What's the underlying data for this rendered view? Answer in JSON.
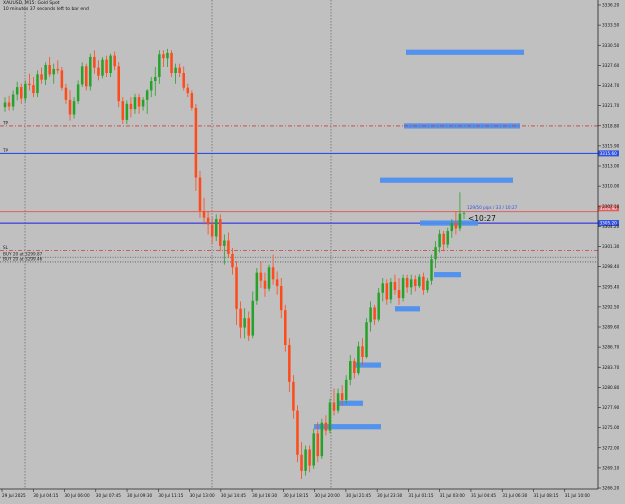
{
  "window": {
    "symbol_line": "XAUUSD, M15:  Gold Spot",
    "timer_line": "10 minutes 37 seconds left to bar end"
  },
  "colors": {
    "background": "#c0c0c0",
    "bull": "#26a22a",
    "bear": "#ff4a1a",
    "zone": "#4d8fef",
    "level_blue": "#1f3ff0",
    "level_red": "#d23b3b",
    "ask_line": "#e06060",
    "bid_line": "#1a1ae6",
    "grid": "#555555",
    "price_tag": "#3050e0"
  },
  "chart_data": {
    "type": "candlestick",
    "symbol": "XAUUSD",
    "timeframe": "M15",
    "ylim": [
      3265.5,
      3338.5
    ],
    "y_ticks": [
      "3336.20",
      "3333.50",
      "3330.50",
      "3327.60",
      "3324.70",
      "3321.70",
      "3318.80",
      "3315.90",
      "3313.00",
      "3310.00",
      "3307.10",
      "3304.20",
      "3301.30",
      "3298.40",
      "3295.40",
      "3292.50",
      "3289.60",
      "3286.70",
      "3283.70",
      "3280.80",
      "3277.90",
      "3275.00",
      "3272.00",
      "3269.10",
      "3266.20"
    ],
    "x_ticks": [
      "29 Jul 2025",
      "30 Jul 04:15",
      "30 Jul 06:00",
      "30 Jul 07:45",
      "30 Jul 09:30",
      "30 Jul 11:15",
      "30 Jul 13:00",
      "30 Jul 14:45",
      "30 Jul 16:30",
      "30 Jul 18:15",
      "30 Jul 20:00",
      "30 Jul 21:45",
      "30 Jul 23:30",
      "31 Jul 01:15",
      "31 Jul 03:00",
      "31 Jul 04:45",
      "31 Jul 06:30",
      "31 Jul 08:15",
      "31 Jul 10:00"
    ],
    "candles": [
      [
        3322.5,
        3324.0,
        3321.8,
        3323.2
      ],
      [
        3323.2,
        3324.2,
        3322.0,
        3322.6
      ],
      [
        3322.6,
        3325.0,
        3322.0,
        3324.4
      ],
      [
        3324.4,
        3326.3,
        3323.5,
        3325.5
      ],
      [
        3325.5,
        3326.0,
        3323.0,
        3323.8
      ],
      [
        3323.8,
        3326.5,
        3323.2,
        3326.0
      ],
      [
        3326.0,
        3327.5,
        3325.0,
        3325.8
      ],
      [
        3325.8,
        3327.0,
        3324.0,
        3324.6
      ],
      [
        3324.6,
        3328.0,
        3324.0,
        3327.4
      ],
      [
        3327.4,
        3328.4,
        3326.0,
        3326.6
      ],
      [
        3326.6,
        3329.2,
        3325.8,
        3328.8
      ],
      [
        3328.8,
        3330.0,
        3327.0,
        3327.4
      ],
      [
        3327.4,
        3329.0,
        3326.0,
        3328.2
      ],
      [
        3328.2,
        3329.5,
        3327.5,
        3328.0
      ],
      [
        3328.0,
        3328.5,
        3325.0,
        3325.4
      ],
      [
        3325.4,
        3326.0,
        3323.0,
        3323.6
      ],
      [
        3323.6,
        3325.0,
        3320.5,
        3321.4
      ],
      [
        3321.4,
        3324.0,
        3320.8,
        3323.4
      ],
      [
        3323.4,
        3326.5,
        3323.0,
        3325.9
      ],
      [
        3325.9,
        3329.2,
        3325.5,
        3328.6
      ],
      [
        3328.6,
        3329.0,
        3325.0,
        3325.6
      ],
      [
        3325.6,
        3330.5,
        3325.0,
        3330.0
      ],
      [
        3330.0,
        3331.0,
        3327.5,
        3328.4
      ],
      [
        3328.4,
        3329.5,
        3326.5,
        3327.2
      ],
      [
        3327.2,
        3330.0,
        3326.8,
        3329.6
      ],
      [
        3329.6,
        3330.2,
        3327.0,
        3327.6
      ],
      [
        3327.6,
        3330.5,
        3327.0,
        3330.2
      ],
      [
        3330.2,
        3330.8,
        3328.0,
        3328.6
      ],
      [
        3328.6,
        3329.2,
        3322.5,
        3323.4
      ],
      [
        3323.4,
        3324.0,
        3320.0,
        3320.6
      ],
      [
        3320.6,
        3323.5,
        3320.0,
        3323.0
      ],
      [
        3323.0,
        3324.0,
        3321.0,
        3322.2
      ],
      [
        3322.2,
        3324.5,
        3321.5,
        3324.0
      ],
      [
        3324.0,
        3324.5,
        3321.5,
        3322.6
      ],
      [
        3322.6,
        3324.0,
        3322.0,
        3323.6
      ],
      [
        3323.6,
        3325.2,
        3321.5,
        3325.0
      ],
      [
        3325.0,
        3327.0,
        3324.0,
        3326.4
      ],
      [
        3326.4,
        3328.5,
        3324.2,
        3327.0
      ],
      [
        3327.0,
        3331.0,
        3326.0,
        3330.4
      ],
      [
        3330.4,
        3331.0,
        3328.5,
        3329.8
      ],
      [
        3329.8,
        3331.2,
        3328.5,
        3330.6
      ],
      [
        3330.6,
        3331.0,
        3327.0,
        3327.6
      ],
      [
        3327.6,
        3329.0,
        3326.0,
        3328.4
      ],
      [
        3328.4,
        3329.0,
        3327.0,
        3327.6
      ],
      [
        3327.6,
        3328.6,
        3325.0,
        3325.4
      ],
      [
        3325.4,
        3326.0,
        3324.0,
        3324.6
      ],
      [
        3324.6,
        3325.0,
        3322.0,
        3322.4
      ],
      [
        3322.4,
        3323.0,
        3310.0,
        3312.0
      ],
      [
        3312.0,
        3313.0,
        3306.0,
        3307.0
      ],
      [
        3307.0,
        3309.0,
        3305.0,
        3306.0
      ],
      [
        3306.0,
        3307.0,
        3303.5,
        3305.0
      ],
      [
        3305.0,
        3306.0,
        3302.0,
        3303.2
      ],
      [
        3303.2,
        3306.5,
        3302.5,
        3305.8
      ],
      [
        3305.8,
        3306.5,
        3301.0,
        3301.8
      ],
      [
        3301.8,
        3303.5,
        3299.0,
        3302.6
      ],
      [
        3302.6,
        3303.8,
        3300.0,
        3300.6
      ],
      [
        3300.6,
        3301.5,
        3297.5,
        3298.6
      ],
      [
        3298.6,
        3299.5,
        3290.0,
        3292.4
      ],
      [
        3292.4,
        3293.5,
        3288.0,
        3289.6
      ],
      [
        3289.6,
        3292.5,
        3288.0,
        3291.0
      ],
      [
        3291.0,
        3292.0,
        3287.6,
        3288.4
      ],
      [
        3288.4,
        3295.0,
        3288.0,
        3293.6
      ],
      [
        3293.6,
        3298.5,
        3293.0,
        3297.8
      ],
      [
        3297.8,
        3299.5,
        3295.5,
        3296.6
      ],
      [
        3296.6,
        3297.8,
        3294.2,
        3295.4
      ],
      [
        3295.4,
        3299.0,
        3295.0,
        3298.6
      ],
      [
        3298.6,
        3300.5,
        3296.0,
        3296.8
      ],
      [
        3296.8,
        3298.0,
        3294.5,
        3295.8
      ],
      [
        3295.8,
        3297.0,
        3291.0,
        3292.2
      ],
      [
        3292.2,
        3293.0,
        3286.0,
        3287.0
      ],
      [
        3287.0,
        3288.0,
        3280.0,
        3281.5
      ],
      [
        3281.5,
        3282.5,
        3276.0,
        3277.2
      ],
      [
        3277.2,
        3278.0,
        3269.5,
        3270.6
      ],
      [
        3270.6,
        3272.5,
        3267.0,
        3268.2
      ],
      [
        3268.2,
        3272.0,
        3267.5,
        3271.4
      ],
      [
        3271.4,
        3272.0,
        3268.0,
        3269.0
      ],
      [
        3269.0,
        3274.5,
        3268.5,
        3273.8
      ],
      [
        3273.8,
        3275.5,
        3269.5,
        3270.4
      ],
      [
        3270.4,
        3276.0,
        3270.0,
        3275.4
      ],
      [
        3275.4,
        3276.5,
        3273.5,
        3274.2
      ],
      [
        3274.2,
        3279.0,
        3273.8,
        3278.4
      ],
      [
        3278.4,
        3280.5,
        3276.5,
        3277.2
      ],
      [
        3277.2,
        3280.5,
        3276.8,
        3279.8
      ],
      [
        3279.8,
        3281.0,
        3278.0,
        3278.8
      ],
      [
        3278.8,
        3282.5,
        3278.2,
        3281.8
      ],
      [
        3281.8,
        3285.5,
        3281.0,
        3284.6
      ],
      [
        3284.6,
        3285.0,
        3282.0,
        3282.8
      ],
      [
        3282.8,
        3287.5,
        3282.5,
        3286.8
      ],
      [
        3286.8,
        3288.0,
        3284.0,
        3285.2
      ],
      [
        3285.2,
        3291.0,
        3285.0,
        3290.4
      ],
      [
        3290.4,
        3293.5,
        3289.0,
        3292.6
      ],
      [
        3292.6,
        3293.0,
        3290.0,
        3290.8
      ],
      [
        3290.8,
        3295.5,
        3290.5,
        3294.8
      ],
      [
        3294.8,
        3297.0,
        3293.5,
        3296.2
      ],
      [
        3296.2,
        3296.8,
        3293.0,
        3293.8
      ],
      [
        3293.8,
        3297.0,
        3293.2,
        3296.4
      ],
      [
        3296.4,
        3297.5,
        3294.5,
        3295.2
      ],
      [
        3295.2,
        3297.0,
        3293.0,
        3294.0
      ],
      [
        3294.0,
        3297.5,
        3293.5,
        3297.0
      ],
      [
        3297.0,
        3297.5,
        3294.8,
        3295.6
      ],
      [
        3295.6,
        3297.5,
        3294.5,
        3296.8
      ],
      [
        3296.8,
        3297.4,
        3295.0,
        3295.8
      ],
      [
        3295.8,
        3297.6,
        3295.5,
        3297.2
      ],
      [
        3297.2,
        3297.8,
        3294.5,
        3295.2
      ],
      [
        3295.2,
        3297.0,
        3294.8,
        3296.6
      ],
      [
        3296.6,
        3300.5,
        3296.0,
        3299.8
      ],
      [
        3299.8,
        3302.5,
        3298.5,
        3301.6
      ],
      [
        3301.6,
        3304.2,
        3300.8,
        3303.6
      ],
      [
        3303.6,
        3304.0,
        3301.0,
        3302.0
      ],
      [
        3302.0,
        3304.5,
        3301.5,
        3304.0
      ],
      [
        3304.0,
        3305.8,
        3303.0,
        3305.2
      ],
      [
        3305.2,
        3307.0,
        3303.5,
        3304.4
      ],
      [
        3304.4,
        3309.8,
        3304.0,
        3306.6
      ],
      [
        3306.6,
        3306.9,
        3305.8,
        3306.7
      ]
    ],
    "zones": [
      {
        "x0": 406,
        "x1": 524,
        "price": 3330.7
      },
      {
        "x0": 404,
        "x1": 520,
        "price": 3319.7,
        "dotted": true
      },
      {
        "x0": 380,
        "x1": 513,
        "price": 3311.6
      },
      {
        "x0": 420,
        "x1": 478,
        "price": 3305.2
      },
      {
        "x0": 434,
        "x1": 461,
        "price": 3297.5
      },
      {
        "x0": 395,
        "x1": 420,
        "price": 3292.4
      },
      {
        "x0": 354,
        "x1": 381,
        "price": 3284.0
      },
      {
        "x0": 338,
        "x1": 363,
        "price": 3278.3
      },
      {
        "x0": 314,
        "x1": 381,
        "price": 3274.8
      }
    ],
    "levels": [
      {
        "name": "tp2",
        "label": "TP",
        "price": 3319.7,
        "color": "#d23b3b",
        "style": "dashdot"
      },
      {
        "name": "tp1",
        "label": "TP",
        "price": 3315.6,
        "color": "#1f3ff0",
        "style": "solid"
      },
      {
        "name": "ask",
        "label": "",
        "price": 3306.9,
        "color": "#e06060",
        "style": "solid"
      },
      {
        "name": "bid",
        "label": "",
        "price": 3305.2,
        "color": "#1a1ae6",
        "style": "solid"
      },
      {
        "name": "sl",
        "label": "SL",
        "price": 3301.1,
        "color": "#d23b3b",
        "style": "dashdot"
      },
      {
        "name": "buy1",
        "label": "BUY 20 at 3299.87",
        "price": 3300.1,
        "color": "#555555",
        "style": "dotted"
      },
      {
        "name": "buy2",
        "label": "BUY 20 at 3299.46",
        "price": 3299.4,
        "color": "#555555",
        "style": "dotted"
      }
    ],
    "price_tags": [
      {
        "price": 3315.6,
        "text": "3315.60"
      },
      {
        "price": 3307.4,
        "text": "3306.90"
      },
      {
        "price": 3305.2,
        "text": "3305.20"
      }
    ],
    "countdown": {
      "text": "<10:27",
      "price": 3305.8
    },
    "spread_info": {
      "text": "129/50 pips / 33 / 10:27",
      "price": 3307.5
    }
  }
}
